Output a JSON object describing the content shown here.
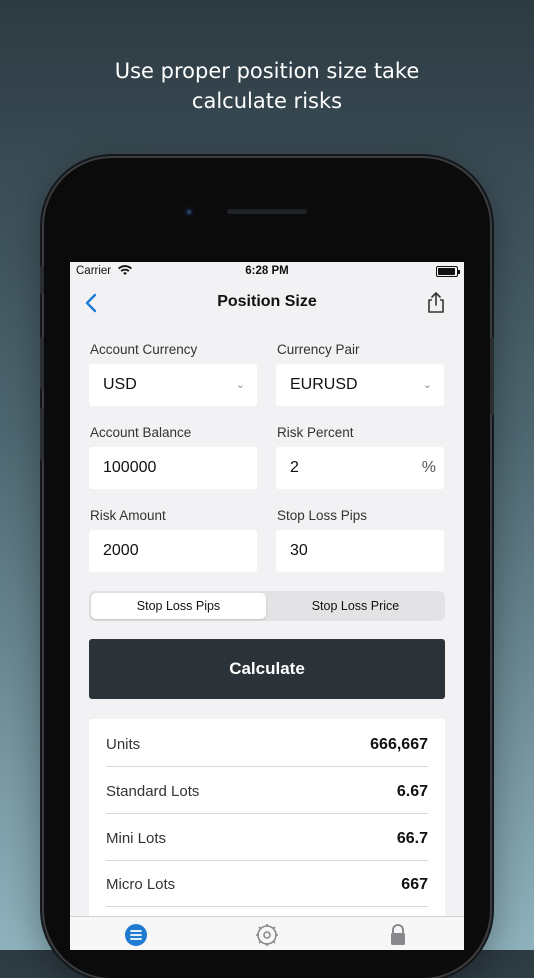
{
  "headline": {
    "line1": "Use proper position size take",
    "line2": "calculate risks"
  },
  "status_bar": {
    "carrier": "Carrier",
    "time": "6:28 PM"
  },
  "nav": {
    "title": "Position Size",
    "back_icon": "chevron-left-icon",
    "share_icon": "share-icon"
  },
  "form": {
    "account_currency": {
      "label": "Account Currency",
      "value": "USD"
    },
    "currency_pair": {
      "label": "Currency Pair",
      "value": "EURUSD"
    },
    "account_balance": {
      "label": "Account Balance",
      "value": "100000"
    },
    "risk_percent": {
      "label": "Risk Percent",
      "value": "2",
      "suffix": "%"
    },
    "risk_amount": {
      "label": "Risk Amount",
      "value": "2000"
    },
    "stop_loss_pips": {
      "label": "Stop Loss Pips",
      "value": "30"
    }
  },
  "segment": {
    "options": [
      "Stop Loss Pips",
      "Stop Loss Price"
    ],
    "selected": "Stop Loss Pips"
  },
  "calculate_label": "Calculate",
  "results": [
    {
      "label": "Units",
      "value": "666,667"
    },
    {
      "label": "Standard Lots",
      "value": "6.67"
    },
    {
      "label": "Mini Lots",
      "value": "66.7"
    },
    {
      "label": "Micro Lots",
      "value": "667"
    }
  ],
  "tabs": [
    {
      "icon": "list-icon",
      "active": true
    },
    {
      "icon": "gear-icon",
      "active": false
    },
    {
      "icon": "lock-icon",
      "active": false
    }
  ],
  "colors": {
    "accent": "#1f7ad1",
    "button": "#2b3338"
  }
}
